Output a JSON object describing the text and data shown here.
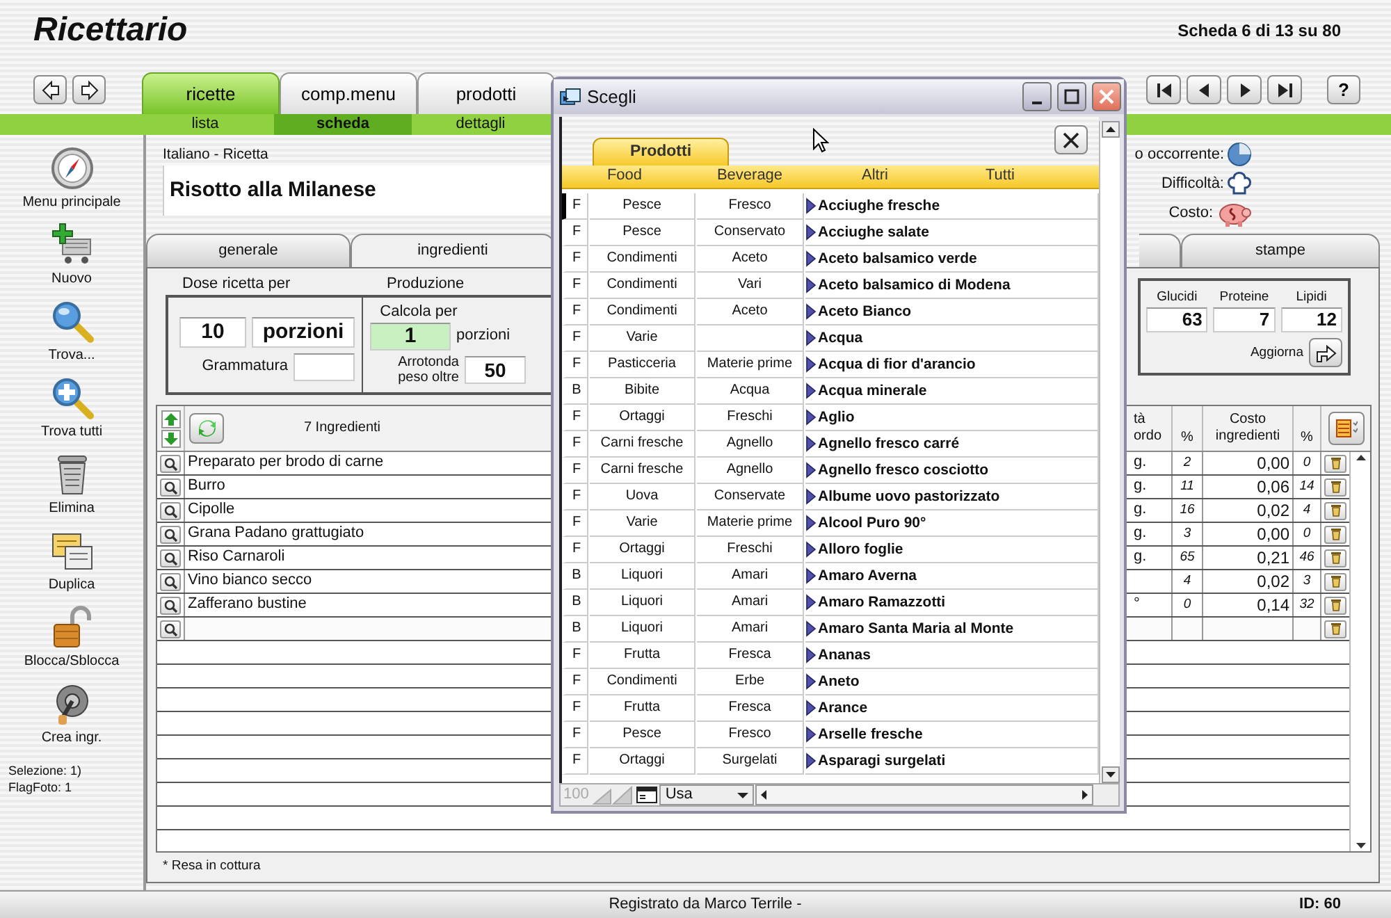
{
  "app": {
    "title": "Ricettario",
    "record_position": "Scheda 6 di 13 su 80",
    "help": "?"
  },
  "main_tabs": [
    {
      "label": "ricette",
      "selected": true
    },
    {
      "label": "comp.menu",
      "selected": false
    },
    {
      "label": "prodotti",
      "selected": false
    }
  ],
  "sub_tabs": [
    {
      "label": "lista",
      "selected": false
    },
    {
      "label": "scheda",
      "selected": true
    },
    {
      "label": "dettagli",
      "selected": false
    }
  ],
  "sidebar": {
    "items": [
      {
        "label": "Menu principale",
        "kind": "compass"
      },
      {
        "label": "Nuovo",
        "kind": "new"
      },
      {
        "label": "Trova...",
        "kind": "find"
      },
      {
        "label": "Trova tutti",
        "kind": "find_all"
      },
      {
        "label": "Elimina",
        "kind": "delete"
      },
      {
        "label": "Duplica",
        "kind": "duplicate"
      },
      {
        "label": "Blocca/Sblocca",
        "kind": "lock"
      },
      {
        "label": "Crea ingr.",
        "kind": "create"
      }
    ],
    "selection": "Selezione:  1)",
    "flag_photo": "FlagFoto: 1"
  },
  "recipe": {
    "language_label": "Italiano - Ricetta",
    "name": "Risotto alla Milanese",
    "info": [
      {
        "label": "o occorrente:",
        "kind": "time"
      },
      {
        "label": "Difficoltà:",
        "kind": "difficulty"
      },
      {
        "label": "Costo:",
        "kind": "cost"
      }
    ]
  },
  "section_tabs": [
    {
      "label": "generale",
      "selected": false
    },
    {
      "label": "ingredienti",
      "selected": true
    },
    {
      "label": "stampe",
      "selected": false
    }
  ],
  "dose": {
    "title": "Dose ricetta per",
    "quantity": "10",
    "unit": "porzioni",
    "weight_label": "Grammatura"
  },
  "production": {
    "title": "Produzione",
    "calc_label": "Calcola per",
    "calc_value": "1",
    "calc_unit": "porzioni",
    "round_label": "Arrotonda peso oltre",
    "round_value": "50"
  },
  "nutrients": {
    "columns": [
      {
        "label": "Glucidi",
        "value": "63"
      },
      {
        "label": "Proteine",
        "value": "7"
      },
      {
        "label": "Lipidi",
        "value": "12"
      }
    ],
    "update_label": "Aggiorna"
  },
  "ingredients": {
    "count_label": "7 Ingredienti",
    "columns": {
      "qty": [
        "tà",
        "ordo"
      ],
      "pct": "%",
      "cost": "Costo ingredienti",
      "cost_pct": "%"
    },
    "rows": [
      {
        "kind": "item",
        "name": "Preparato per brodo di carne",
        "qty": "g.",
        "pct": "2",
        "cost": "0,00",
        "cost_pct": "0"
      },
      {
        "kind": "item",
        "name": "Burro",
        "qty": "g.",
        "pct": "11",
        "cost": "0,06",
        "cost_pct": "14"
      },
      {
        "kind": "item",
        "name": "Cipolle",
        "qty": "g.",
        "pct": "16",
        "cost": "0,02",
        "cost_pct": "4"
      },
      {
        "kind": "item",
        "name": "Grana Padano grattugiato",
        "qty": "g.",
        "pct": "3",
        "cost": "0,00",
        "cost_pct": "0"
      },
      {
        "kind": "item",
        "name": "Riso Carnaroli",
        "qty": "g.",
        "pct": "65",
        "cost": "0,21",
        "cost_pct": "46"
      },
      {
        "kind": "item",
        "name": "Vino bianco secco",
        "pct": "4",
        "cost": "0,02",
        "cost_pct": "3"
      },
      {
        "kind": "item",
        "name": "Zafferano bustine",
        "qty": "°",
        "pct": "0",
        "cost": "0,14",
        "cost_pct": "32"
      },
      {
        "kind": "blank"
      }
    ],
    "footnote": "* Resa in cottura"
  },
  "dialog": {
    "title": "Scegli",
    "tab": {
      "label": "Prodotti",
      "selected": true
    },
    "filters": [
      "Food",
      "Beverage",
      "Altri",
      "Tutti"
    ],
    "rows": [
      {
        "type": "F",
        "category": "Pesce",
        "subcategory": "Fresco",
        "name": "Acciughe fresche",
        "selected": true
      },
      {
        "type": "F",
        "category": "Pesce",
        "subcategory": "Conservato",
        "name": "Acciughe salate",
        "selected": false
      },
      {
        "type": "F",
        "category": "Condimenti",
        "subcategory": "Aceto",
        "name": "Aceto balsamico verde",
        "selected": false
      },
      {
        "type": "F",
        "category": "Condimenti",
        "subcategory": "Vari",
        "name": "Aceto balsamico di Modena",
        "selected": false
      },
      {
        "type": "F",
        "category": "Condimenti",
        "subcategory": "Aceto",
        "name": "Aceto Bianco",
        "selected": false
      },
      {
        "type": "F",
        "category": "Varie",
        "name": "Acqua",
        "selected": false
      },
      {
        "type": "F",
        "category": "Pasticceria",
        "subcategory": "Materie prime",
        "name": "Acqua di fior d'arancio",
        "selected": false
      },
      {
        "type": "B",
        "category": "Bibite",
        "subcategory": "Acqua",
        "name": "Acqua minerale",
        "selected": false
      },
      {
        "type": "F",
        "category": "Ortaggi",
        "subcategory": "Freschi",
        "name": "Aglio",
        "selected": false
      },
      {
        "type": "F",
        "category": "Carni fresche",
        "subcategory": "Agnello",
        "name": "Agnello fresco carré",
        "selected": false
      },
      {
        "type": "F",
        "category": "Carni fresche",
        "subcategory": "Agnello",
        "name": "Agnello fresco cosciotto",
        "selected": false
      },
      {
        "type": "F",
        "category": "Uova",
        "subcategory": "Conservate",
        "name": "Albume uovo pastorizzato",
        "selected": false
      },
      {
        "type": "F",
        "category": "Varie",
        "subcategory": "Materie prime",
        "name": "Alcool Puro 90°",
        "selected": false
      },
      {
        "type": "F",
        "category": "Ortaggi",
        "subcategory": "Freschi",
        "name": "Alloro foglie",
        "selected": false
      },
      {
        "type": "B",
        "category": "Liquori",
        "subcategory": "Amari",
        "name": "Amaro Averna",
        "selected": false
      },
      {
        "type": "B",
        "category": "Liquori",
        "subcategory": "Amari",
        "name": "Amaro Ramazzotti",
        "selected": false
      },
      {
        "type": "B",
        "category": "Liquori",
        "subcategory": "Amari",
        "name": "Amaro Santa Maria al Monte",
        "selected": false
      },
      {
        "type": "F",
        "category": "Frutta",
        "subcategory": "Fresca",
        "name": "Ananas",
        "selected": false
      },
      {
        "type": "F",
        "category": "Condimenti",
        "subcategory": "Erbe",
        "name": "Aneto",
        "selected": false
      },
      {
        "type": "F",
        "category": "Frutta",
        "subcategory": "Fresca",
        "name": "Arance",
        "selected": false
      },
      {
        "type": "F",
        "category": "Pesce",
        "subcategory": "Fresco",
        "name": "Arselle fresche",
        "selected": false
      },
      {
        "type": "F",
        "category": "Ortaggi",
        "subcategory": "Surgelati",
        "name": "Asparagi surgelati",
        "selected": false
      }
    ],
    "zoom": "100",
    "view": "Usa"
  },
  "status_bar": {
    "registered_by": "Registrato da Marco Terrile -",
    "record_id": "ID: 60"
  }
}
